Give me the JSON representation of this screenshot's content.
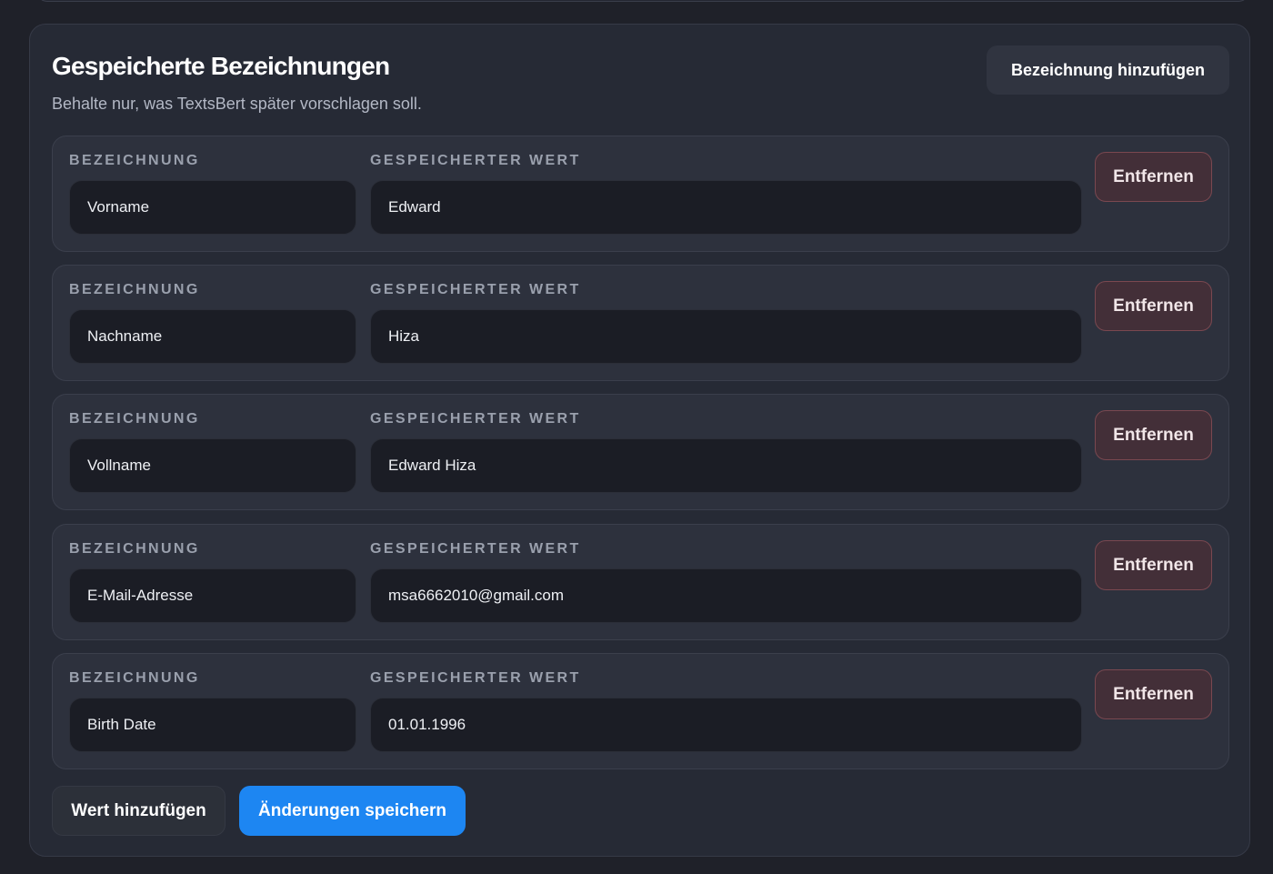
{
  "section": {
    "title": "Gespeicherte Bezeichnungen",
    "subtitle": "Behalte nur, was TextsBert später vorschlagen soll.",
    "add_label_button": "Bezeichnung hinzufügen"
  },
  "columns": {
    "label_header": "BEZEICHNUNG",
    "value_header": "GESPEICHERTER WERT"
  },
  "entries": [
    {
      "label": "Vorname",
      "value": "Edward",
      "remove": "Entfernen"
    },
    {
      "label": "Nachname",
      "value": "Hiza",
      "remove": "Entfernen"
    },
    {
      "label": "Vollname",
      "value": "Edward Hiza",
      "remove": "Entfernen"
    },
    {
      "label": "E-Mail-Adresse",
      "value": "msa6662010@gmail.com",
      "remove": "Entfernen"
    },
    {
      "label": "Birth Date",
      "value": "01.01.1996",
      "remove": "Entfernen"
    }
  ],
  "footer": {
    "add_value_button": "Wert hinzufügen",
    "save_button": "Änderungen speichern"
  },
  "colors": {
    "background": "#1f2129",
    "panel": "#262a35",
    "row": "#2d313d",
    "field": "#1b1d25",
    "accent": "#1d86f2",
    "danger_bg": "#432f38",
    "danger_border": "#7a4850"
  }
}
